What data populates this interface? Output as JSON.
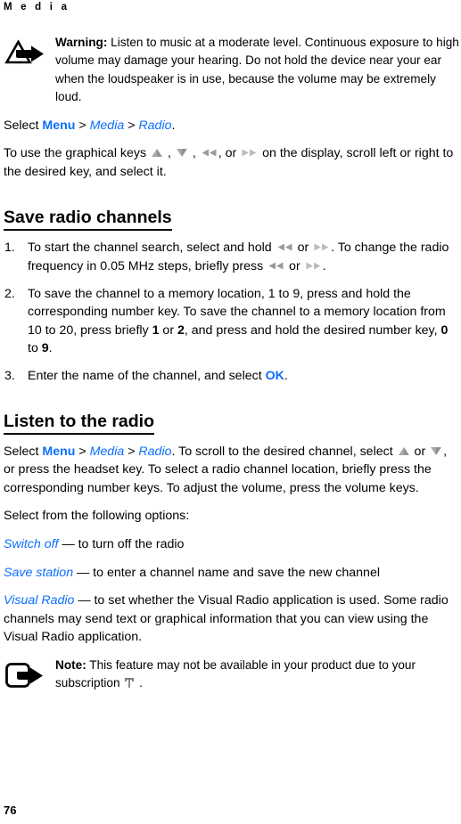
{
  "header": {
    "running_title": "M e d i a"
  },
  "warning": {
    "icon": "warning-triangle-arrow-icon",
    "label": "Warning:",
    "text": " Listen to music at a moderate level. Continuous exposure to high volume may damage your hearing. Do not hold the device near your ear when the loudspeaker is in use, because the volume may be extremely loud."
  },
  "intro": {
    "select_prefix": "Select ",
    "menu": "Menu",
    "sep": " > ",
    "media": "Media",
    "radio": "Radio",
    "period": ".",
    "graphical_keys_prefix": "To use the graphical keys ",
    "graphical_keys_comma": " , ",
    "graphical_keys_or": ", or ",
    "graphical_keys_suffix": " on the display, scroll left or right to the desired key, and select it."
  },
  "save_section": {
    "heading": "Save radio channels",
    "steps": [
      {
        "num": "1.",
        "part1": "To start the channel search, select and hold ",
        "or": " or ",
        "part2": ". To change the radio frequency in 0.05 MHz steps, briefly press ",
        "part3": "."
      },
      {
        "num": "2.",
        "part1": "To save the channel to a memory location, 1 to 9, press and hold the corresponding number key. To save the channel to a memory location from 10 to 20, press briefly ",
        "key1": "1",
        "or": " or ",
        "key2": "2",
        "part2": ", and press and hold the desired number key, ",
        "key3": "0",
        "to": " to ",
        "key4": "9",
        "part3": "."
      },
      {
        "num": "3.",
        "part1": "Enter the name of the channel, and select ",
        "ok": "OK",
        "part2": "."
      }
    ]
  },
  "listen_section": {
    "heading": "Listen to the radio",
    "para1_prefix": "Select ",
    "menu": "Menu",
    "sep": " > ",
    "media": "Media",
    "radio": "Radio",
    "para1_mid": ". To scroll to the desired channel, select ",
    "para1_or": " or ",
    "para1_suffix": ", or press the headset key. To select a radio channel location, briefly press the corresponding number keys. To adjust the volume, press the volume keys.",
    "options_intro": "Select from the following options:",
    "options": [
      {
        "name": "Switch off",
        "dash": " — ",
        "desc": "to turn off the radio"
      },
      {
        "name": "Save station",
        "dash": " — ",
        "desc": "to enter a channel name and save the new channel"
      },
      {
        "name": "Visual Radio",
        "dash": " — ",
        "desc": "to set whether the Visual Radio application is used. Some radio channels may send text or graphical information that you can view using the Visual Radio application."
      }
    ]
  },
  "note": {
    "icon": "note-rounded-square-arrow-icon",
    "label": "Note:",
    "text_before": " This feature may not be available in your product due to your subscription ",
    "text_after": " ."
  },
  "footer": {
    "page_number": "76"
  },
  "colors": {
    "ui_blue": "#0d6efd",
    "key_gray_dark": "#9a9a9a",
    "key_gray_light": "#bcbcbc",
    "text": "#000000",
    "background": "#ffffff"
  }
}
